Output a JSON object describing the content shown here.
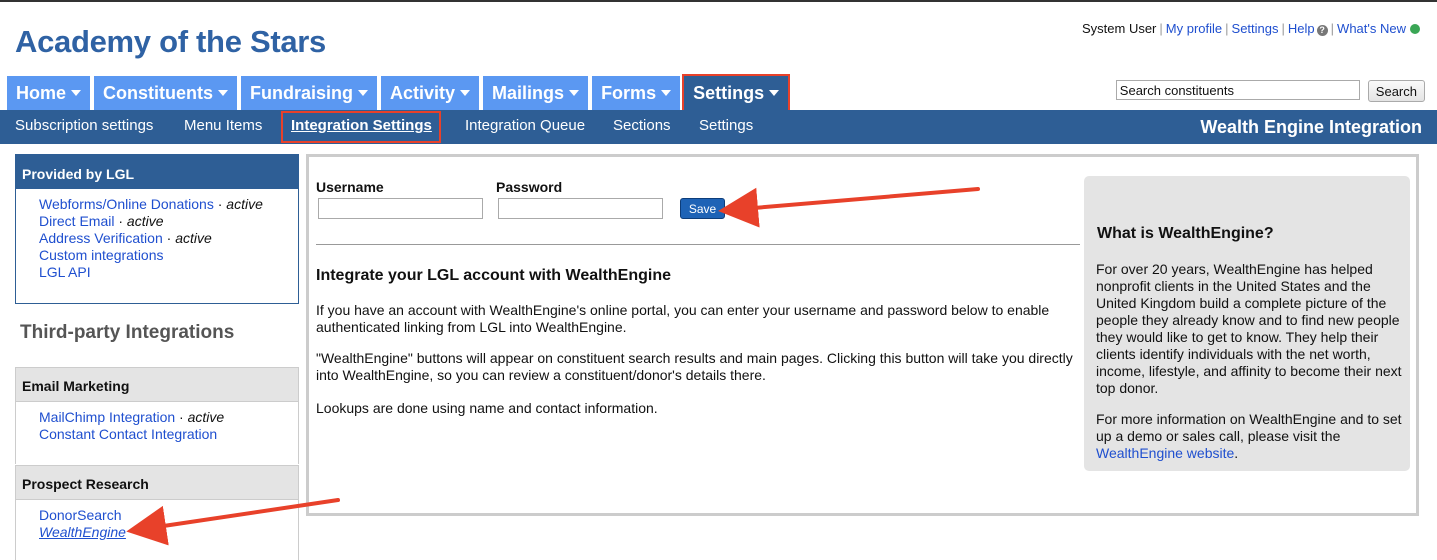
{
  "app": {
    "title": "Academy of the Stars"
  },
  "userlinks": {
    "user": "System User",
    "my_profile": "My profile",
    "settings": "Settings",
    "help": "Help",
    "help_icon": "?",
    "whats_new": "What's New",
    "status_color": "#3aa655"
  },
  "nav": {
    "tabs": [
      {
        "label": "Home"
      },
      {
        "label": "Constituents"
      },
      {
        "label": "Fundraising"
      },
      {
        "label": "Activity"
      },
      {
        "label": "Mailings"
      },
      {
        "label": "Forms"
      },
      {
        "label": "Settings",
        "active": true
      }
    ]
  },
  "search": {
    "value": "Search constituents",
    "button": "Search"
  },
  "subnav": {
    "items": [
      {
        "label": "Subscription settings"
      },
      {
        "label": "Menu Items"
      },
      {
        "label": "Integration Settings",
        "active": true
      },
      {
        "label": "Integration Queue"
      },
      {
        "label": "Sections"
      },
      {
        "label": "Settings"
      }
    ],
    "section_title": "Wealth Engine Integration"
  },
  "sidebar": {
    "lgl": {
      "title": "Provided by LGL",
      "items": [
        {
          "label": "Webforms/Online Donations",
          "state": "active"
        },
        {
          "label": "Direct Email",
          "state": "active"
        },
        {
          "label": "Address Verification",
          "state": "active"
        },
        {
          "label": "Custom integrations"
        },
        {
          "label": "LGL API"
        }
      ]
    },
    "third_party_title": "Third-party Integrations",
    "email_marketing": {
      "title": "Email Marketing",
      "items": [
        {
          "label": "MailChimp Integration",
          "state": "active"
        },
        {
          "label": "Constant Contact Integration"
        }
      ]
    },
    "prospect_research": {
      "title": "Prospect Research",
      "items": [
        {
          "label": "DonorSearch"
        },
        {
          "label": "WealthEngine",
          "current": true
        }
      ]
    }
  },
  "form": {
    "username_label": "Username",
    "password_label": "Password",
    "username_value": "",
    "password_value": "",
    "save_label": "Save"
  },
  "main": {
    "heading": "Integrate your LGL account with WealthEngine",
    "para1": "If you have an account with WealthEngine's online portal, you can enter your username and password below to enable authenticated linking from LGL into WealthEngine.",
    "para2": "\"WealthEngine\" buttons will appear on constituent search results and main pages. Clicking this button will take you directly into WealthEngine, so you can review a constituent/donor's details there.",
    "para3": "Lookups are done using name and contact information."
  },
  "info": {
    "title": "What is WealthEngine?",
    "body": "For over 20 years, WealthEngine has helped nonprofit clients in the United States and the United Kingdom build a complete picture of the people they already know and to find new people they would like to get to know. They help their clients identify individuals with the net worth, income, lifestyle, and affinity to become their next top donor.",
    "more_prefix": "For more information on WealthEngine and to set up a demo or sales call, please visit the",
    "more_link": "WealthEngine website",
    "more_suffix": "."
  },
  "colors": {
    "brand_blue": "#2f62a4",
    "tab_blue": "#5b98f2",
    "nav_dark": "#2e5e95",
    "highlight_red": "#e8412a"
  }
}
